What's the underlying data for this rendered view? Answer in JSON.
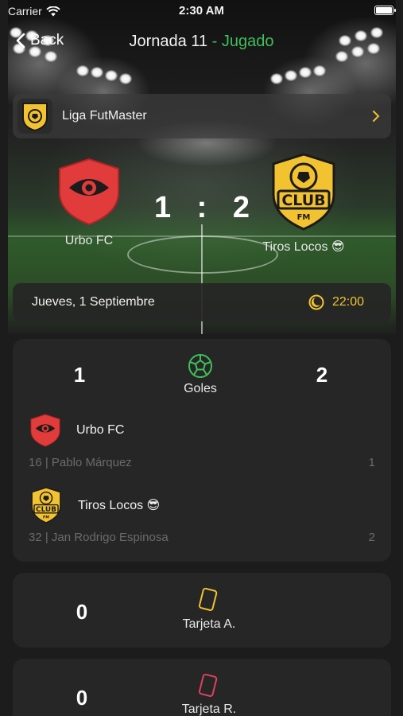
{
  "status_bar": {
    "carrier": "Carrier",
    "time": "2:30 AM"
  },
  "nav": {
    "back_label": "Back",
    "title": "Jornada 11",
    "separator": "-",
    "status": "Jugado",
    "status_color": "#3fbf5a"
  },
  "league": {
    "name": "Liga FutMaster",
    "icon": "club-fm-logo"
  },
  "match": {
    "home": {
      "name": "Urbo FC",
      "score": "1",
      "crest": "red-eye-shield",
      "color": "#e23b3b"
    },
    "away": {
      "name": "Tiros Locos 😎",
      "score": "2",
      "crest": "club-fm-logo",
      "color": "#f2c230"
    },
    "separator": ":",
    "date": "Jueves, 1 Septiembre",
    "time": "22:00"
  },
  "stats": {
    "goals": {
      "label": "Goles",
      "home_value": "1",
      "away_value": "2",
      "icon": "soccer-ball-icon",
      "scorers": [
        {
          "team": "Urbo FC",
          "player": "16 | Pablo Márquez",
          "count": "1"
        },
        {
          "team": "Tiros Locos 😎",
          "player": "32 | Jan Rodrigo Espinosa",
          "count": "2"
        }
      ]
    },
    "yellow_cards": {
      "label": "Tarjeta A.",
      "value": "0",
      "icon": "yellow-card-icon",
      "color": "#f2c230"
    },
    "red_cards": {
      "label": "Tarjeta R.",
      "value": "0",
      "icon": "red-card-icon",
      "color": "#e04060"
    }
  }
}
